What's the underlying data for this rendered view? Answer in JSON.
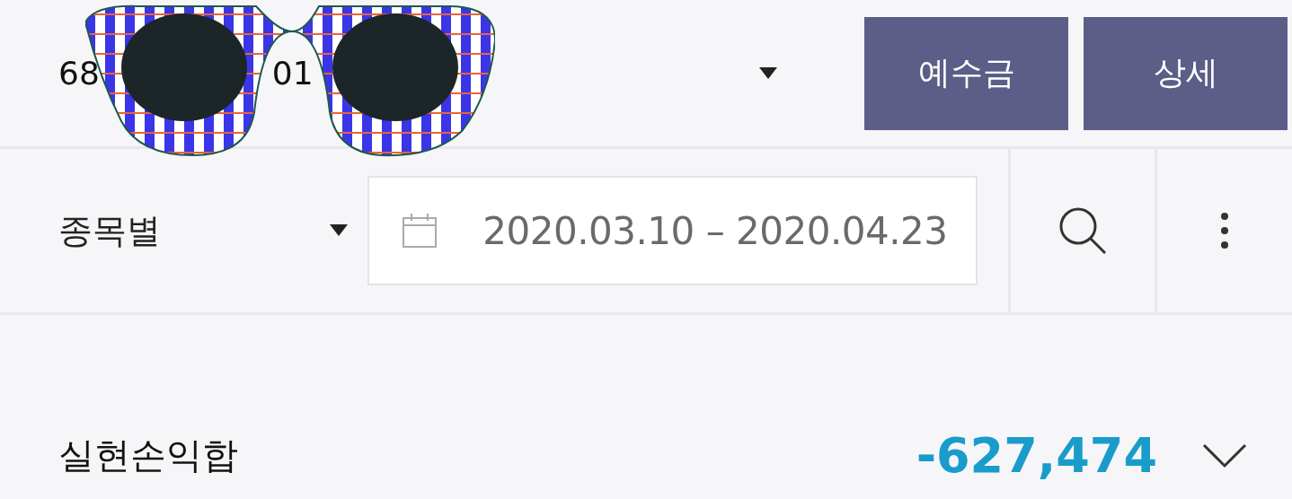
{
  "account": {
    "parts": [
      "68",
      "01"
    ]
  },
  "buttons": [
    "예수금",
    "상세"
  ],
  "filter": {
    "label": "종목별",
    "date_range": "2020.03.10 – 2020.04.23"
  },
  "summary": {
    "label": "실현손익합",
    "value": "-627,474",
    "expanded": false
  }
}
